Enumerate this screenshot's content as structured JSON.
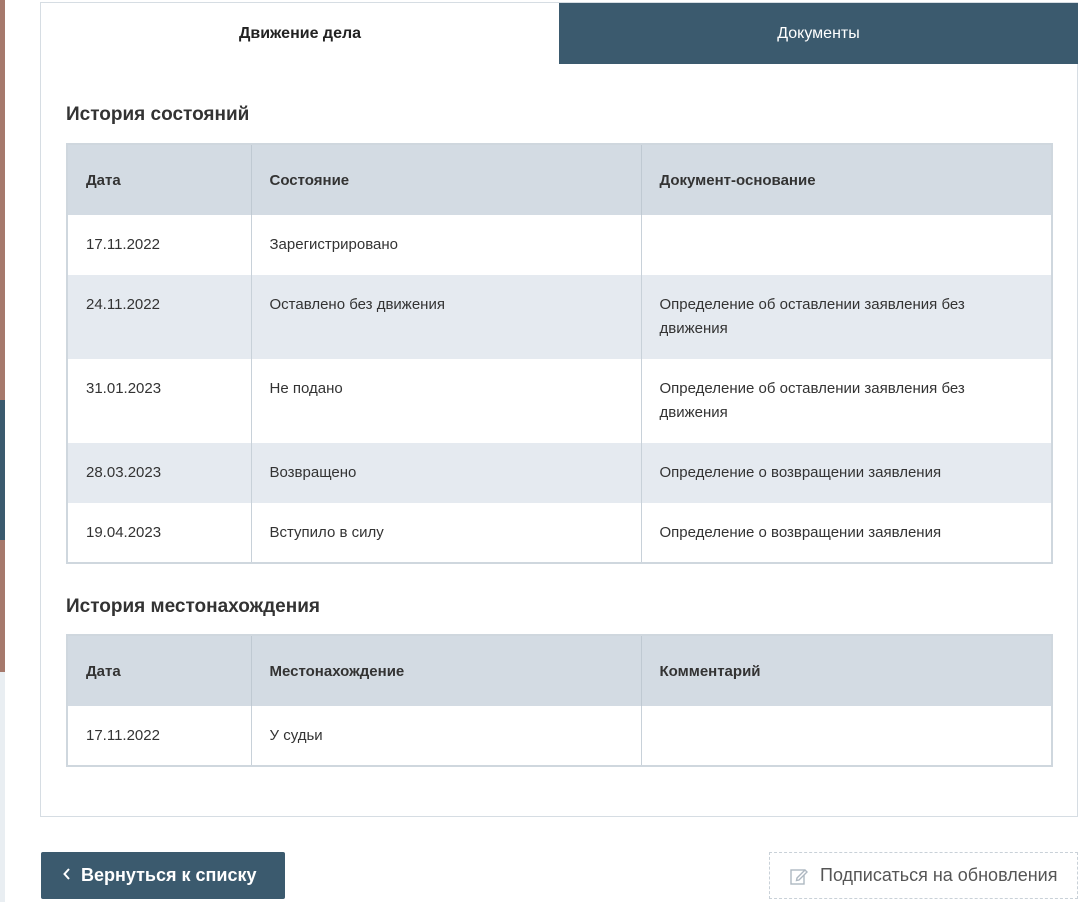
{
  "tabs": [
    {
      "label": "Движение дела",
      "active": true
    },
    {
      "label": "Документы",
      "active": false
    }
  ],
  "state_history": {
    "title": "История состояний",
    "headers": [
      "Дата",
      "Состояние",
      "Документ-основание"
    ],
    "rows": [
      [
        "17.11.2022",
        "Зарегистрировано",
        ""
      ],
      [
        "24.11.2022",
        "Оставлено без движения",
        "Определение об оставлении заявления без движения"
      ],
      [
        "31.01.2023",
        "Не подано",
        "Определение об оставлении заявления без движения"
      ],
      [
        "28.03.2023",
        "Возвращено",
        "Определение о возвращении заявления"
      ],
      [
        "19.04.2023",
        "Вступило в силу",
        "Определение о возвращении заявления"
      ]
    ]
  },
  "location_history": {
    "title": "История местонахождения",
    "headers": [
      "Дата",
      "Местонахождение",
      "Комментарий"
    ],
    "rows": [
      [
        "17.11.2022",
        "У судьи",
        ""
      ]
    ]
  },
  "buttons": {
    "back_label": "Вернуться к списку",
    "subscribe_label": "Подписаться на обновления"
  },
  "colors": {
    "accent": "#3b5a6e",
    "header_bg": "#d3dbe3",
    "row_alt": "#e5eaf0"
  },
  "icons": {
    "back": "chevron-left-icon",
    "subscribe": "edit-icon"
  }
}
